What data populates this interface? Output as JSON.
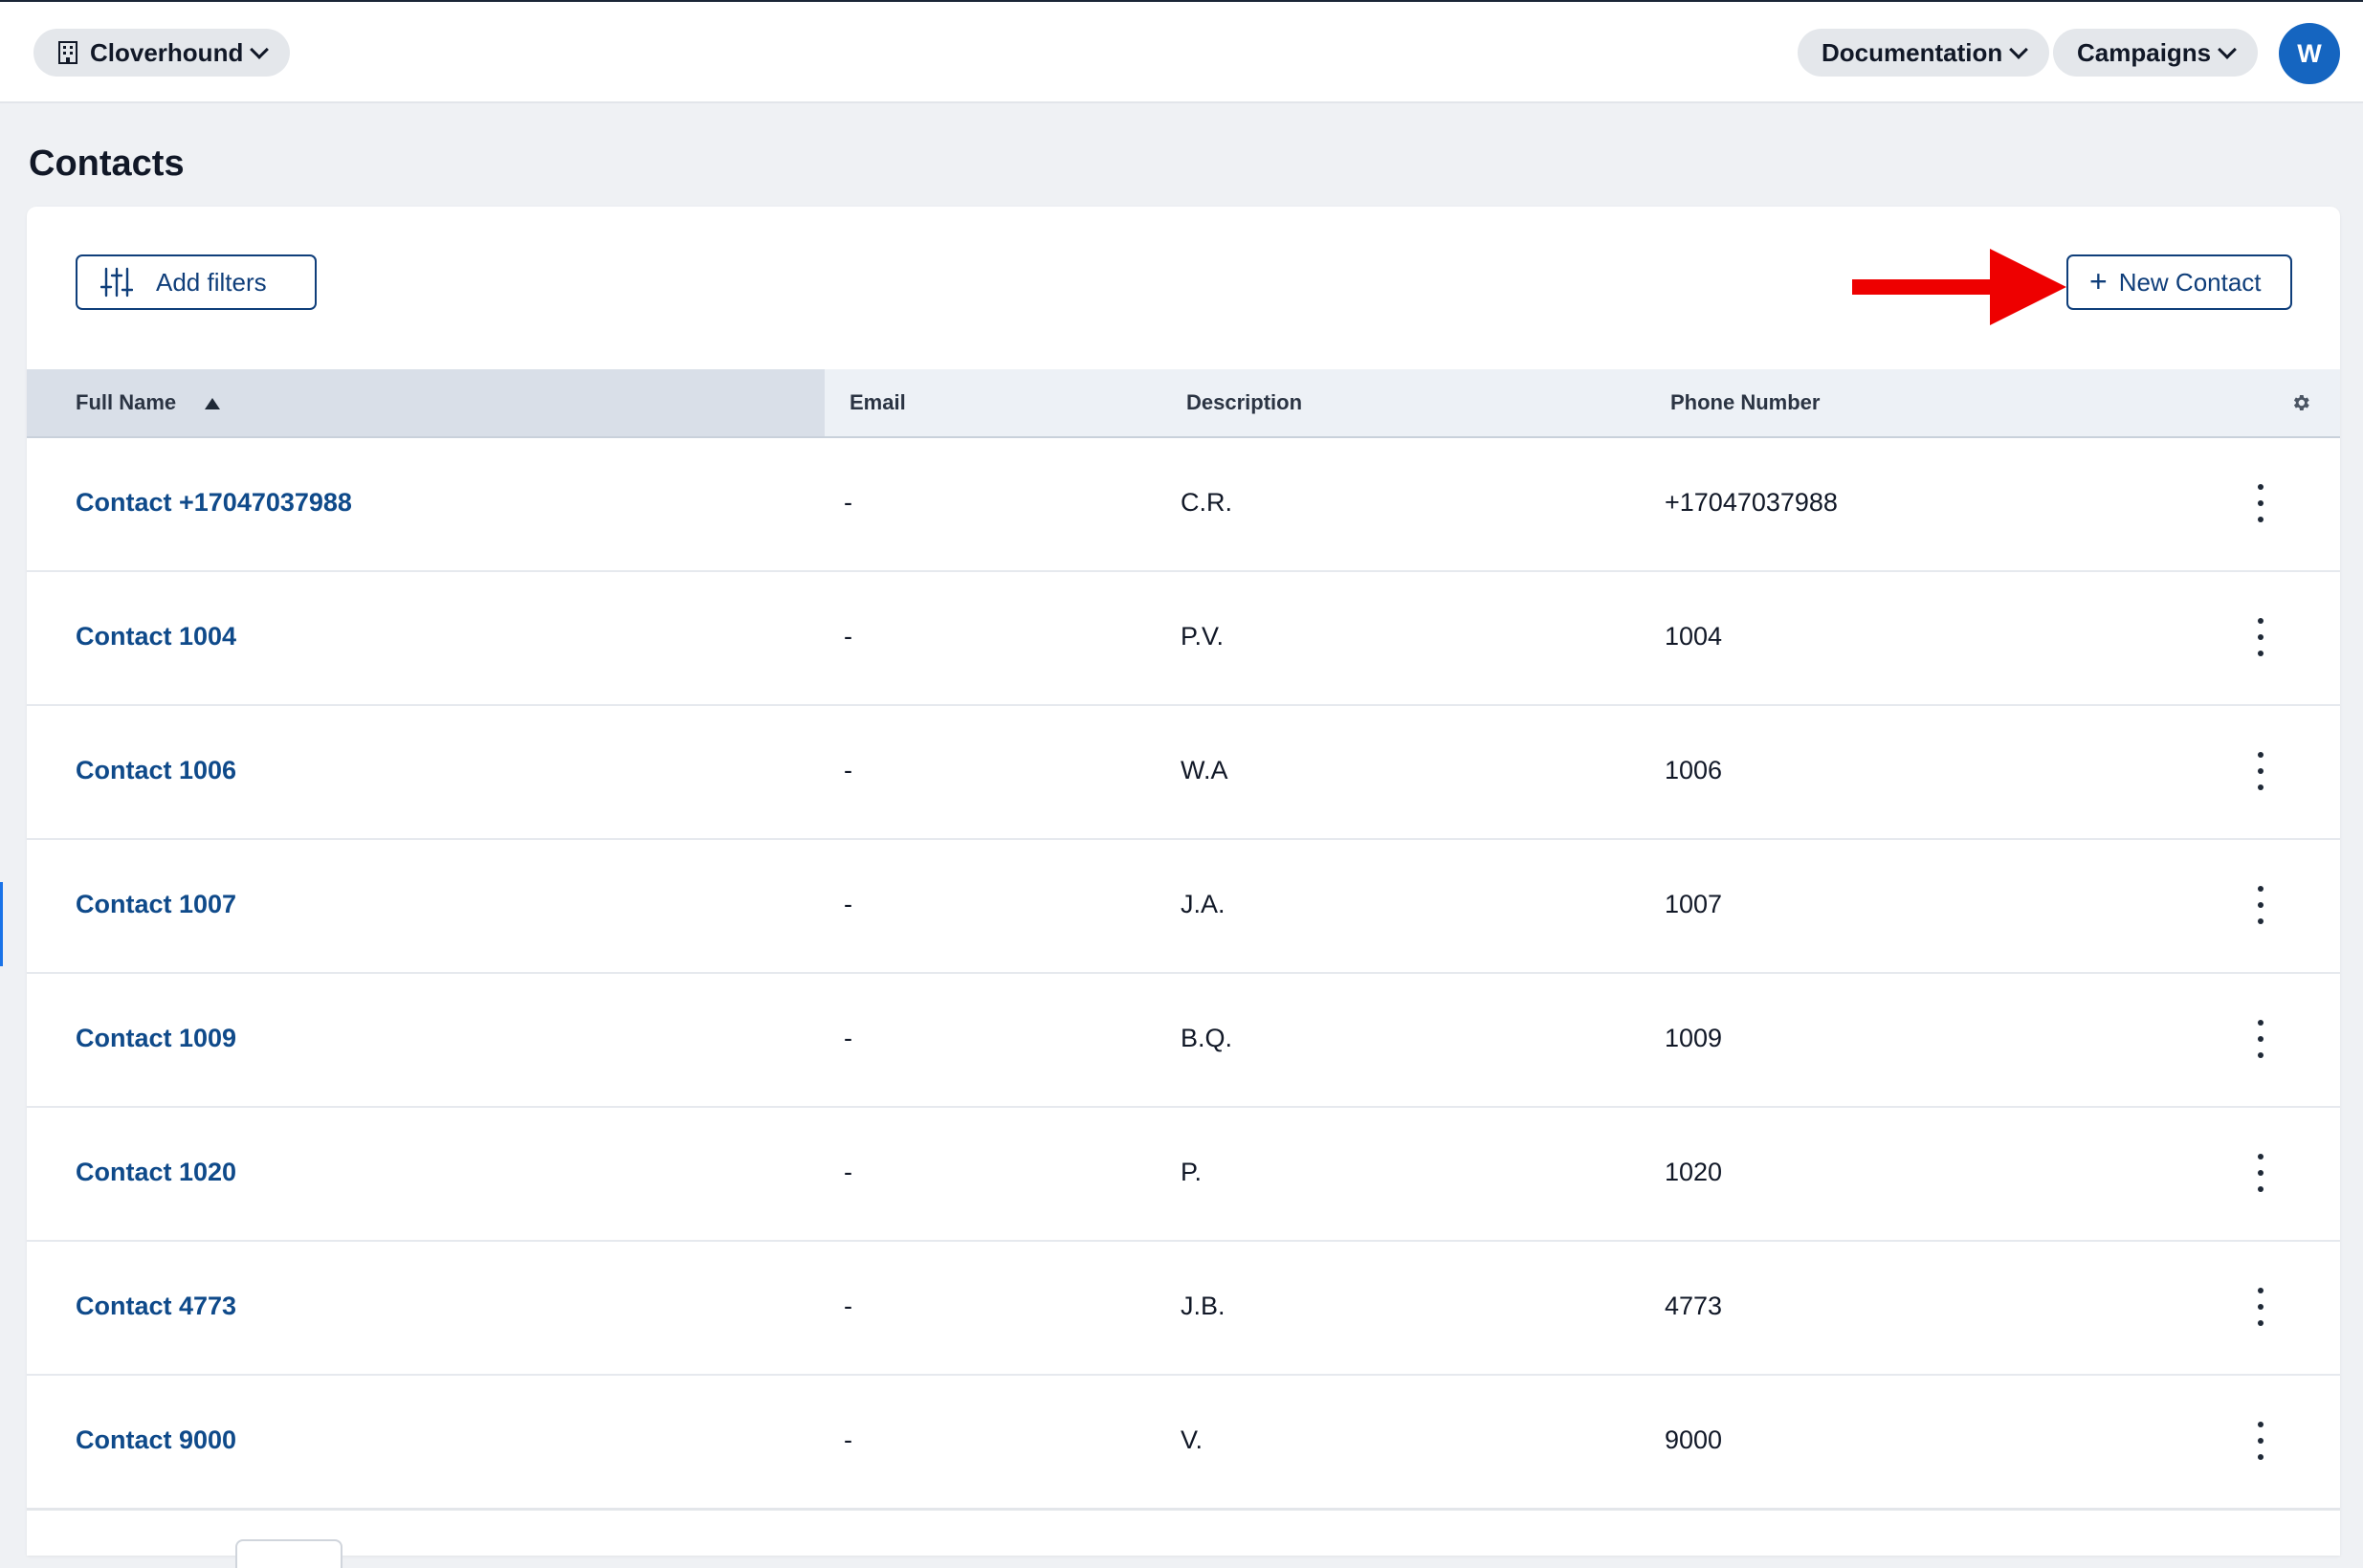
{
  "header": {
    "org_name": "Cloverhound",
    "documentation_label": "Documentation",
    "campaigns_label": "Campaigns",
    "avatar_initial": "W"
  },
  "page": {
    "title": "Contacts"
  },
  "toolbar": {
    "add_filters_label": "Add filters",
    "new_contact_label": "New Contact"
  },
  "table": {
    "columns": [
      "Full Name",
      "Email",
      "Description",
      "Phone Number"
    ],
    "sort": {
      "column": "Full Name",
      "direction": "ascending"
    },
    "rows": [
      {
        "full_name": "Contact +17047037988",
        "email": "-",
        "description": "C.R.",
        "phone": "+17047037988"
      },
      {
        "full_name": "Contact 1004",
        "email": "-",
        "description": "P.V.",
        "phone": "1004"
      },
      {
        "full_name": "Contact 1006",
        "email": "-",
        "description": "W.A",
        "phone": "1006"
      },
      {
        "full_name": "Contact 1007",
        "email": "-",
        "description": "J.A.",
        "phone": "1007"
      },
      {
        "full_name": "Contact 1009",
        "email": "-",
        "description": "B.Q.",
        "phone": "1009"
      },
      {
        "full_name": "Contact 1020",
        "email": "-",
        "description": "P.",
        "phone": "1020"
      },
      {
        "full_name": "Contact 4773",
        "email": "-",
        "description": "J.B.",
        "phone": "4773"
      },
      {
        "full_name": "Contact 9000",
        "email": "-",
        "description": "V.",
        "phone": "9000"
      }
    ]
  },
  "icons": {
    "org": "building-icon",
    "filters": "sliders-icon",
    "add": "plus-icon",
    "settings": "gear-icon",
    "row_menu": "more-vertical-icon",
    "annotation": "red-arrow"
  },
  "colors": {
    "link": "#0f4a8a",
    "accent": "#1565c0",
    "annotation": "#ee0000",
    "page_bg": "#eff1f4"
  }
}
